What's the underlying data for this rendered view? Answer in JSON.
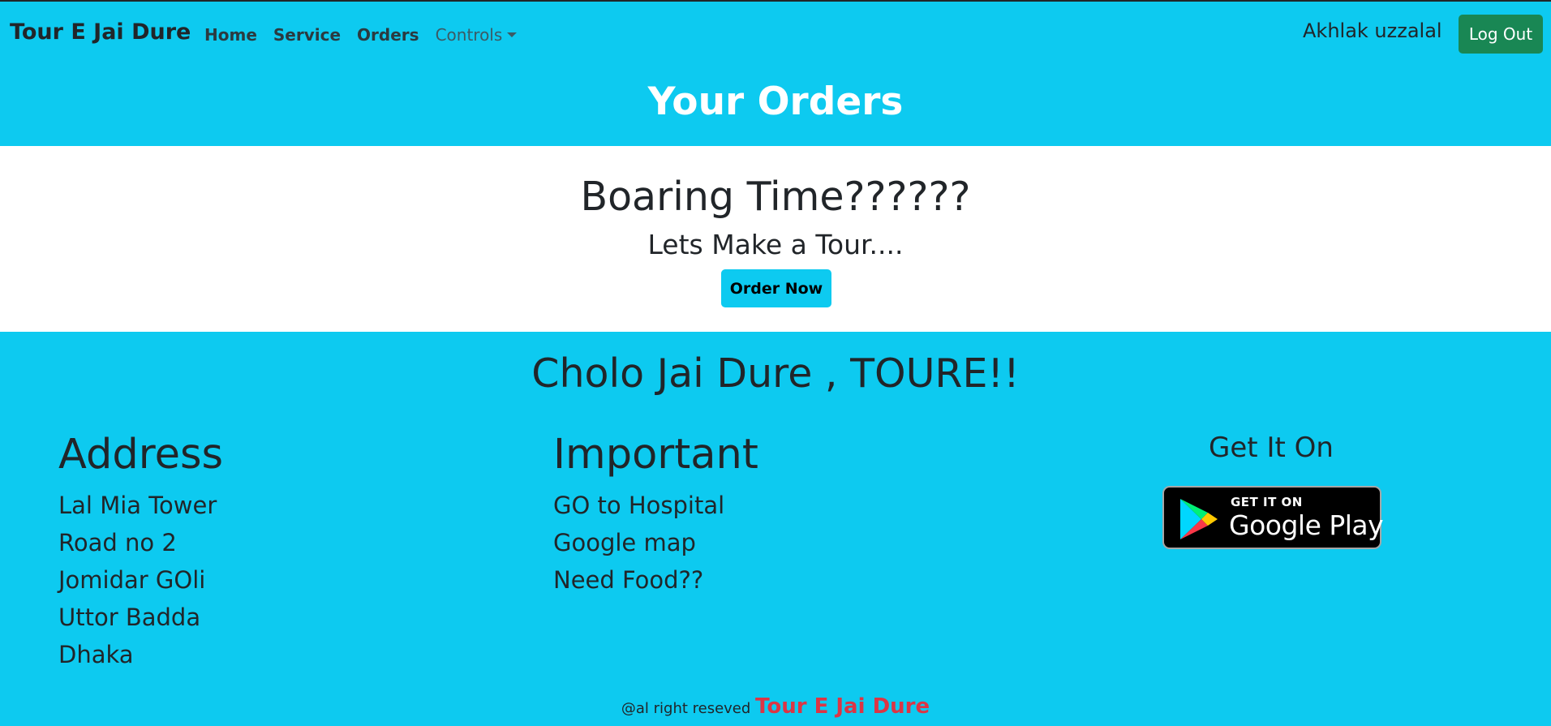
{
  "navbar": {
    "brand": "Tour E Jai Dure",
    "links": [
      "Home",
      "Service",
      "Orders"
    ],
    "dropdown_label": "Controls",
    "user_name": "Akhlak uzzalal",
    "logout_label": "Log Out"
  },
  "page": {
    "title": "Your Orders"
  },
  "hero": {
    "title": "Boaring Time??????",
    "subtitle": "Lets Make a Tour....",
    "button_label": "Order Now"
  },
  "footer": {
    "headline": "Cholo Jai Dure , TOURE!!",
    "address": {
      "heading": "Address",
      "items": [
        "Lal Mia Tower",
        "Road no 2",
        "Jomidar GOli",
        "Uttor Badda",
        "Dhaka"
      ]
    },
    "important": {
      "heading": "Important",
      "items": [
        "GO to Hospital",
        "Google map",
        "Need Food??"
      ]
    },
    "app": {
      "heading": "Get It On",
      "badge_small": "GET IT ON",
      "badge_big": "Google Play"
    },
    "copyright_text": "@al right reseved",
    "copyright_brand": "Tour E Jai Dure"
  },
  "colors": {
    "primary": "#0dcaf0",
    "success": "#198754",
    "danger": "#dc3545",
    "text": "#212529"
  }
}
